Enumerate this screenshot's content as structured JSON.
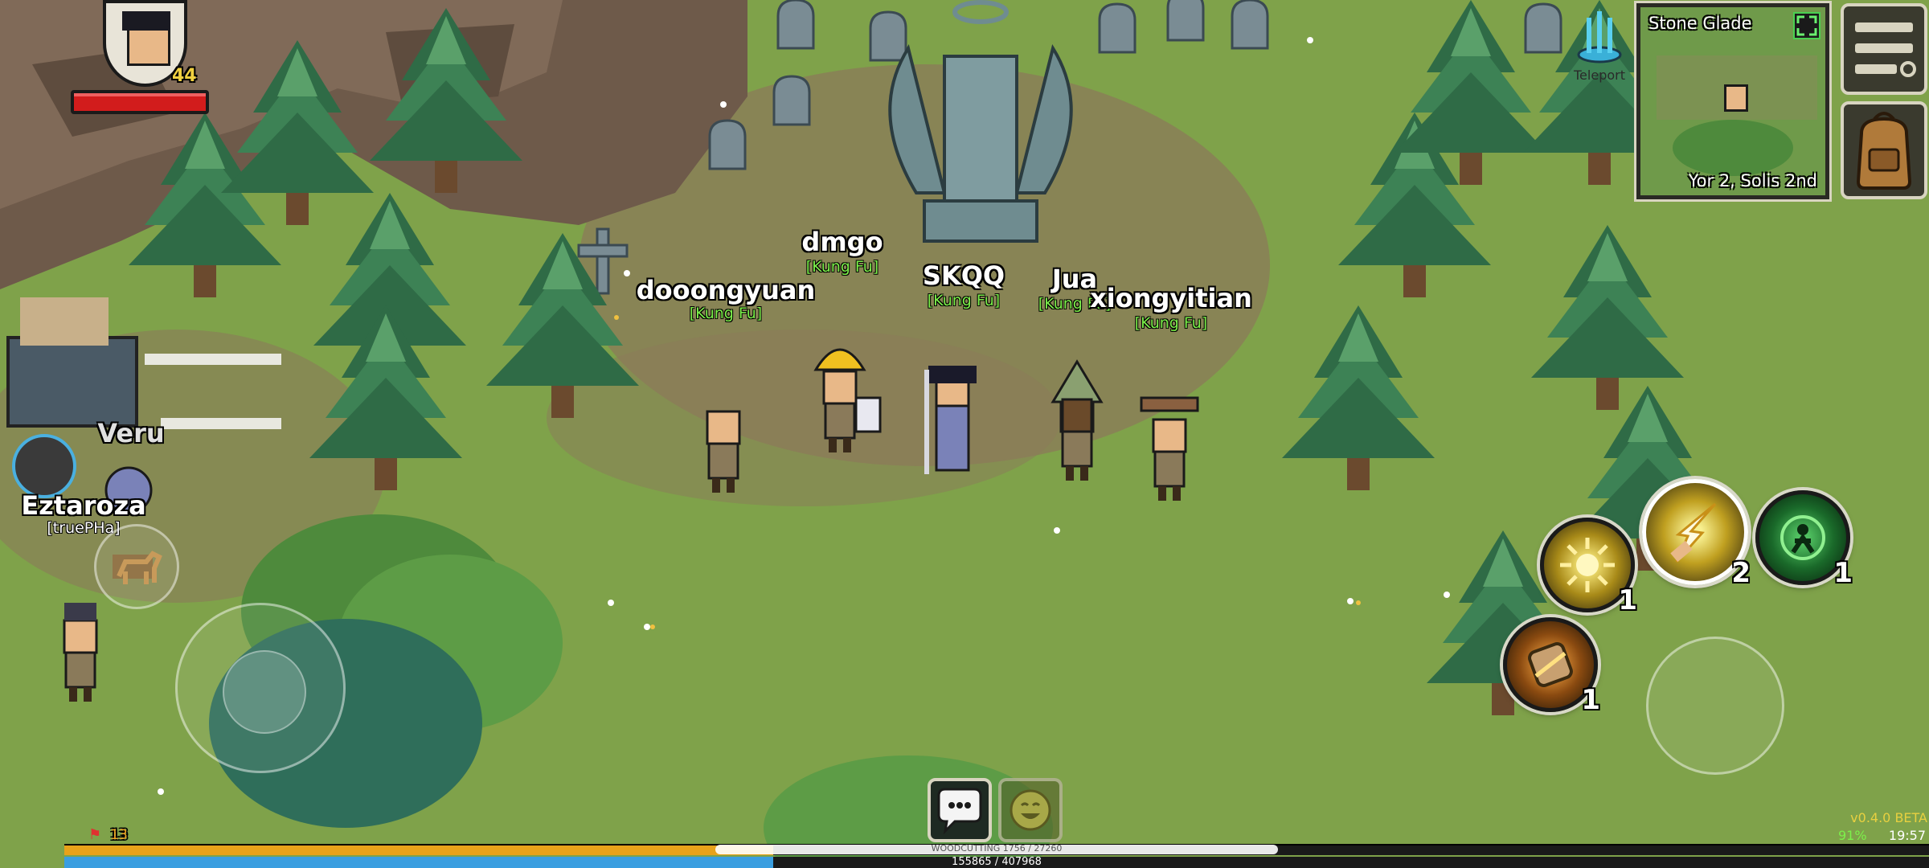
{
  "player": {
    "level": "44",
    "hp_fraction": 1.0
  },
  "minimap": {
    "title": "Stone Glade",
    "date": "Yor 2, Solis 2nd"
  },
  "teleport": {
    "label": "Teleport"
  },
  "players": [
    {
      "name": "dmgo",
      "guild": "[Kung Fu]"
    },
    {
      "name": "dooongyuan",
      "guild": "[Kung Fu]"
    },
    {
      "name": "SKQQ",
      "guild": "[Kung Fu]"
    },
    {
      "name": "Jua",
      "guild": "[Kung Fu]"
    },
    {
      "name": "xiongyitian",
      "guild": "[Kung Fu]"
    },
    {
      "name": "Veru",
      "guild": ""
    },
    {
      "name": "Eztaroza",
      "guild": "[truePHa]"
    }
  ],
  "skills": [
    {
      "name": "sun-burst",
      "count": "1"
    },
    {
      "name": "lightning-strike",
      "count": "2"
    },
    {
      "name": "heal-target",
      "count": "1"
    },
    {
      "name": "scroll-skill",
      "count": "1"
    }
  ],
  "bottom_bar": {
    "notification_count": "13",
    "xp_text": "155865 / 407968",
    "woodcutting_text": "WOODCUTTING 1756 / 27260",
    "version": "v0.4.0 BETA",
    "battery": "91%",
    "time": "19:57",
    "xp_fraction": 0.38,
    "bar2_fraction": 0.38
  },
  "icons": {
    "chat": "chat-bubble-icon",
    "emote": "smile-icon",
    "menu": "hamburger-menu-icon",
    "inventory": "backpack-icon",
    "expand": "expand-icon",
    "teleport": "teleport-icon"
  },
  "colors": {
    "hp": "#d21c1c",
    "xp": "#e8a21a",
    "bar_blue": "#3a9ee0",
    "guild": "#7cf04a"
  }
}
